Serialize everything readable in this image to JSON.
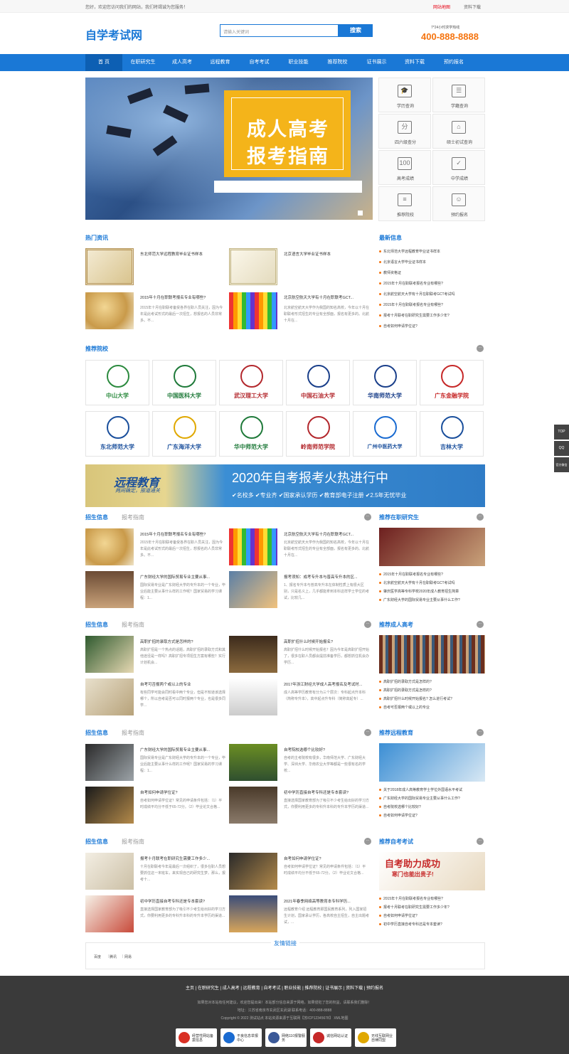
{
  "top": {
    "welcome": "您好，欢迎您访问我们的网站，我们将竭诚为您服务！",
    "link1": "网站地图",
    "link2": "资料下载"
  },
  "header": {
    "logo": "自学考试网",
    "search_placeholder": "请输入关键词",
    "search_btn": "搜索",
    "hot_label": "7*24小时求学热线",
    "hotline": "400-888-8888"
  },
  "nav": [
    "首 页",
    "在职研究生",
    "成人高考",
    "远程教育",
    "自考考试",
    "职业技能",
    "推荐院校",
    "证书展示",
    "资料下载",
    "预约报名"
  ],
  "banner": {
    "line1": "成人高考",
    "line2": "报考指南"
  },
  "quick": [
    "学历查询",
    "学籍查询",
    "四六级查分",
    "硕士初试查询",
    "高考成绩",
    "中学成绩",
    "推荐院校",
    "预约报名"
  ],
  "quick_icons": [
    "cap-icon",
    "id-card-icon",
    "score-icon",
    "sofa-icon",
    "score-100-icon",
    "book-check-icon",
    "school-list-icon",
    "user-icon"
  ],
  "hot": {
    "title": "热门资讯",
    "items": [
      {
        "t": "东北师范大学远程教育毕业证书样本",
        "d": ""
      },
      {
        "t": "北京语言大学毕业证书样本",
        "d": ""
      },
      {
        "t": "2015年十月在职联考报名专业有哪些?",
        "d": "2015年十月在职联考备受各界在职人员关注，因为今年是此考试形式的最后一次招生，想报名的人员非常多。不..."
      },
      {
        "t": "北京航空航天大学有十月在职联考GCT...",
        "d": "北京航空航天大学作为我国的知名高校，今年以十月在职联考形式招生的专业有全部面，报名有更多的。北航十月在..."
      }
    ]
  },
  "latest": {
    "title": "最新信息",
    "items": [
      "东北师范大学远程教育毕业证书样本",
      "北京语言大学毕业证书样本",
      "教师资格证",
      "2015年十月在职联考报名专业有哪些?",
      "北京航空航天大学有十月在职联考GCT考试吗",
      "2015年十月在职联考报名专业有哪些?",
      "报考十月联考在职研究生需要工作多少年?",
      "自考如何申请学位证?"
    ]
  },
  "schools": {
    "title": "推荐院校",
    "names": [
      "中山大学",
      "中国医科大学",
      "武汉理工大学",
      "中国石油大学",
      "华南师范大学",
      "广东金融学院",
      "东北师范大学",
      "广东海洋大学",
      "华中师范大学",
      "岭南师范学院",
      "广州中医药大学",
      "吉林大学"
    ]
  },
  "ad": {
    "left1": "远程教育",
    "left2": "两间确定，报道通关",
    "right1": "2020年自考报考火热进行中",
    "right2": "✔名校多  ✔专业齐  ✔国家承认学历  ✔教育部电子注册  ✔2.5年无忧毕业"
  },
  "blocks": [
    {
      "tab1": "招生信息",
      "tab2": "报考指南",
      "side": "推荐在职研究生",
      "arts": [
        {
          "t": "2015年十月在职联考报名专业有哪些?",
          "d": "2015年十月在职联考备受各界在职人员关注，因为今年是此考试形式的最后一次招生，想报名的人员非常多。不..."
        },
        {
          "t": "北京航空航天大学有十月在职联考GCT...",
          "d": "北京航空航天大学作为我国的知名高校，今年以十月在职联考形式招生的专业有全部面，报名有更多的。北航十月在..."
        },
        {
          "t": "广东财经大学的国际贸易专业主要从事...",
          "d": "国际贸易专业是广东财经大学的专升本的一个专业，毕业后能主要从事什么样的工作呢？国家贸易的学习课程：1..."
        },
        {
          "t": "报考须知：成考专升本与普高专升本的区...",
          "d": "1、报名专升本与普高专升本在体制性质上有很大区别，只是名义上，几乎都能拿到本科这样学士学位的考试，比较几..."
        }
      ],
      "list": [
        "2015年十月在职联考报名专业有哪些?",
        "北京航空航天大学有十月在职联考GCT考试吗",
        "肇庆医学高等专科学校2020年成人教育招生简章",
        "广东财经大学的国际贸易专业主要从事什么工作?"
      ]
    },
    {
      "tab1": "招生信息",
      "tab2": "报考指南",
      "side": "推荐成人高考",
      "arts": [
        {
          "t": "高职扩招的录取方式是怎样的?",
          "d": "高职扩招是一个热点的话题，高职扩招的录取方式和其他途径是一样吗？高职扩招专项招生方案有哪些？实行计划机会..."
        },
        {
          "t": "高职扩招什么时候开始报名?",
          "d": "高职扩招什么时候开始报名？因为今年是高职扩招开始了，很多在职人员都会提前准备学历，都想抓住机会办学历..."
        },
        {
          "t": "自考可否报两个或以上的专业",
          "d": "有些同学可能会同时看中两个专业，但是不知道该选择哪个，所以自考是否可以同时报两个专业，也是很多同学..."
        },
        {
          "t": "2017年浙江财经大学成人高考报名及考试时...",
          "d": "成人高等学历教育有分为三个层次：专科起点升本科（简称专升本），高中起点升专科（简称高起专）..."
        }
      ],
      "list": [
        "高职扩招的录取方式是怎样的?",
        "高职扩招的录取方式是怎样的?",
        "高职扩招什么时候开始报名? 怎么进行考试?",
        "自考可否报两个或以上的专业"
      ]
    },
    {
      "tab1": "招生信息",
      "tab2": "报考指南",
      "side": "推荐远程教育",
      "arts": [
        {
          "t": "广东财经大学的国际贸易专业主要从事...",
          "d": "国际贸易专业是广东财经大学的专升本的一个专业，毕业后能主要从事什么样的工作呢？国家贸易的学习课程：1..."
        },
        {
          "t": "自考院校选哪个比较好?",
          "d": "自考的主考院校有很多，华南师范大学、广东财经大学、深圳大学、华南农业大学等都是一些很有名的学校..."
        },
        {
          "t": "自考如何申请学位证?",
          "d": "自考如何申请学位证？常见的申请条件包括：（1）平时成绩平均分不低于65-72分。（2）毕业论文合格..."
        },
        {
          "t": "初中学历直接自考专科还是专本套读?",
          "d": "直接选择国家教育部为了吸引不少考生给出好的学习方式，你要利用更多的专科升本科的专升本学历的渠道..."
        }
      ],
      "list": [
        "关于2018年成人高等教育学士学位外国语水平考试",
        "广东财经大学的国际贸易专业主要从事什么工作?",
        "自考院校选哪个比较好?",
        "自考如何申请学位证?"
      ]
    },
    {
      "tab1": "招生信息",
      "tab2": "报考指南",
      "side": "推荐自考考试",
      "arts": [
        {
          "t": "报考十月联考在职研究生需要工作多少...",
          "d": "十月在职联考今年是最后一次组织了，很多在职人员想要抓住这一末班车，来实现自己的研究生梦。那么，报考十..."
        },
        {
          "t": "自考如何申请学位证?",
          "d": "自考如何申请学位证？常见的申请条件包括：（1）平时成绩平均分不低于65-72分。（2）毕业论文合格..."
        },
        {
          "t": "初中学历直接自考专科还是专本套读?",
          "d": "直接选择国家教育部为了吸引不少考生给出好的学习方式，你要利用更多的专科升本科的专升本学历的渠道..."
        },
        {
          "t": "2021年春季网络高等教育本专科学历...",
          "d": "远程教育介绍 远程教育即国民教育系列，列入国家招生计划，国家承认学历，各高校自主招生，自主出题考试，..."
        }
      ],
      "list": [
        "2015年十月在职联考报名专业有哪些?",
        "报考十月联考在职研究生需要工作多少年?",
        "自考如何申请学位证?",
        "初中学历直接自考专科还是专本套读?"
      ]
    }
  ],
  "ad_side": {
    "text": "自考助力成功",
    "sub": "寒门也能出贵子!"
  },
  "friend": {
    "title": "友情链接",
    "links": [
      "百度",
      "腾讯",
      "网易"
    ]
  },
  "footer": {
    "nav": "主页  |  在职研究生  |  成人高考  |  远程教育  |  自考考试  |  职业技能  |  推荐院校  |  证书展示  |  资料下载  |  预约报名",
    "l1": "如果您对本站有任何建议，欢迎您提出来！本站部分信息来源于网络，如果侵犯了您的权益，请联系我们删除！",
    "l2": "地址：江苏省南京市玄武区玄武湖    联系电话：400-888-8888",
    "l3": "Copyright © 2022 测试站点 本站资源来源于互联网【苏ICP12345678】 XML地图",
    "badges": [
      "经营性网站备案信息",
      "不良信息举报中心",
      "网络110报警服务",
      "诚信网站认证",
      "无线互联网业自律同盟"
    ]
  },
  "side_btns": [
    "TOP",
    "QQ",
    "官方微信"
  ]
}
